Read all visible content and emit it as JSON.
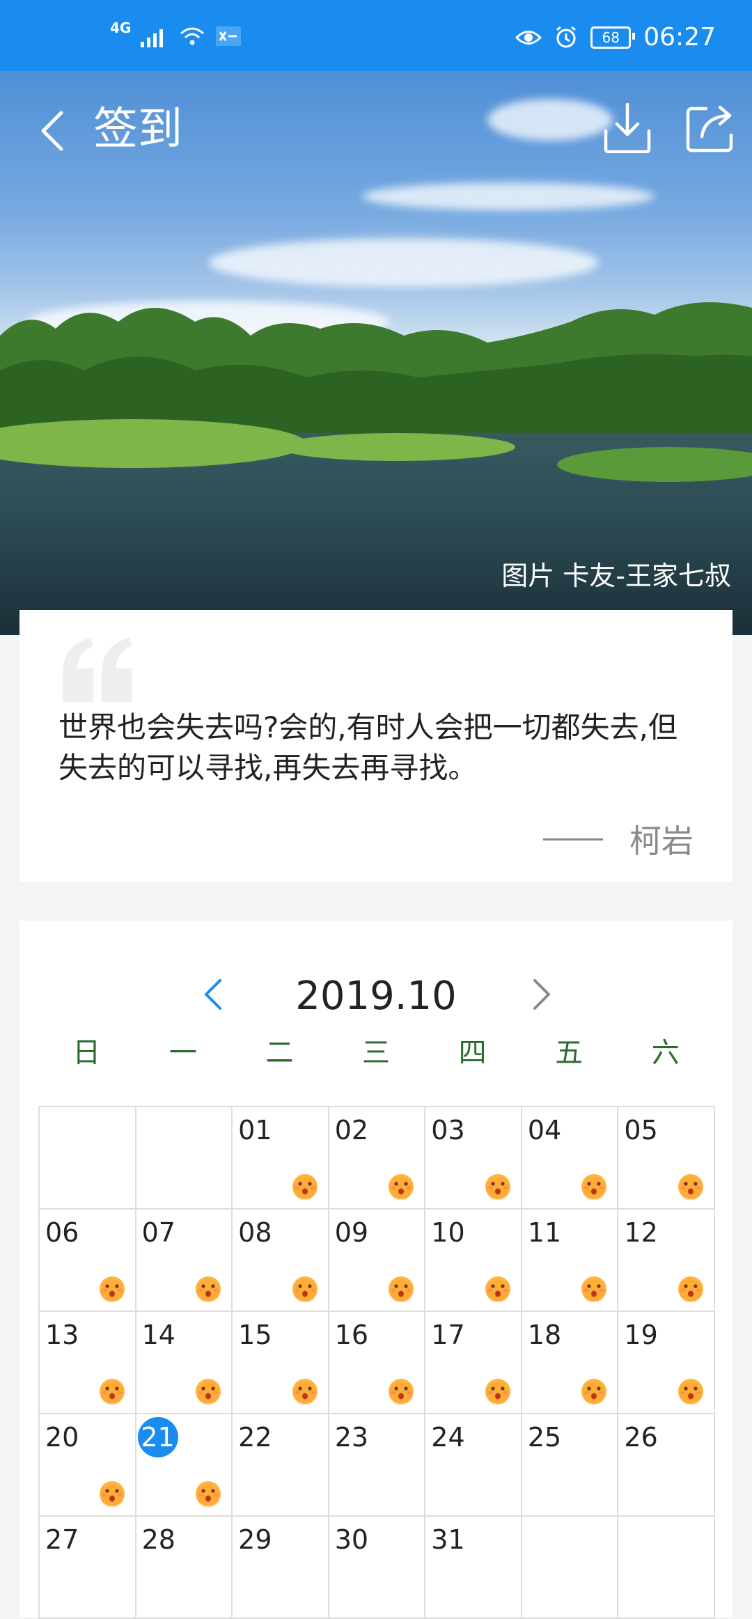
{
  "status_bar": {
    "network": "4G",
    "battery": "68",
    "time": "06:27",
    "icons": [
      "signal-icon",
      "wifi-icon",
      "data-saver-icon",
      "eye-icon",
      "alarm-icon",
      "battery-icon"
    ]
  },
  "header": {
    "title": "签到",
    "icons": [
      "back-icon",
      "download-icon",
      "share-icon"
    ]
  },
  "hero": {
    "credit": "图片 卡友-王家七叔"
  },
  "quote": {
    "text": "世界也会失去吗?会的,有时人会把一切都失去,但失去的可以寻找,再失去再寻找。",
    "author": "柯岩"
  },
  "calendar": {
    "month": "2019.10",
    "weekdays": [
      "日",
      "一",
      "二",
      "三",
      "四",
      "五",
      "六"
    ],
    "today": "21",
    "accent_color": "#1a8cf0",
    "weekday_color": "#2e6b2f",
    "days": [
      {
        "d": "",
        "s": false
      },
      {
        "d": "",
        "s": false
      },
      {
        "d": "01",
        "s": true
      },
      {
        "d": "02",
        "s": true
      },
      {
        "d": "03",
        "s": true
      },
      {
        "d": "04",
        "s": true
      },
      {
        "d": "05",
        "s": true
      },
      {
        "d": "06",
        "s": true
      },
      {
        "d": "07",
        "s": true
      },
      {
        "d": "08",
        "s": true
      },
      {
        "d": "09",
        "s": true
      },
      {
        "d": "10",
        "s": true
      },
      {
        "d": "11",
        "s": true
      },
      {
        "d": "12",
        "s": true
      },
      {
        "d": "13",
        "s": true
      },
      {
        "d": "14",
        "s": true
      },
      {
        "d": "15",
        "s": true
      },
      {
        "d": "16",
        "s": true
      },
      {
        "d": "17",
        "s": true
      },
      {
        "d": "18",
        "s": true
      },
      {
        "d": "19",
        "s": true
      },
      {
        "d": "20",
        "s": true
      },
      {
        "d": "21",
        "s": true
      },
      {
        "d": "22",
        "s": false
      },
      {
        "d": "23",
        "s": false
      },
      {
        "d": "24",
        "s": false
      },
      {
        "d": "25",
        "s": false
      },
      {
        "d": "26",
        "s": false
      },
      {
        "d": "27",
        "s": false
      },
      {
        "d": "28",
        "s": false
      },
      {
        "d": "29",
        "s": false
      },
      {
        "d": "30",
        "s": false
      },
      {
        "d": "31",
        "s": false
      },
      {
        "d": "",
        "s": false
      },
      {
        "d": "",
        "s": false
      }
    ]
  }
}
